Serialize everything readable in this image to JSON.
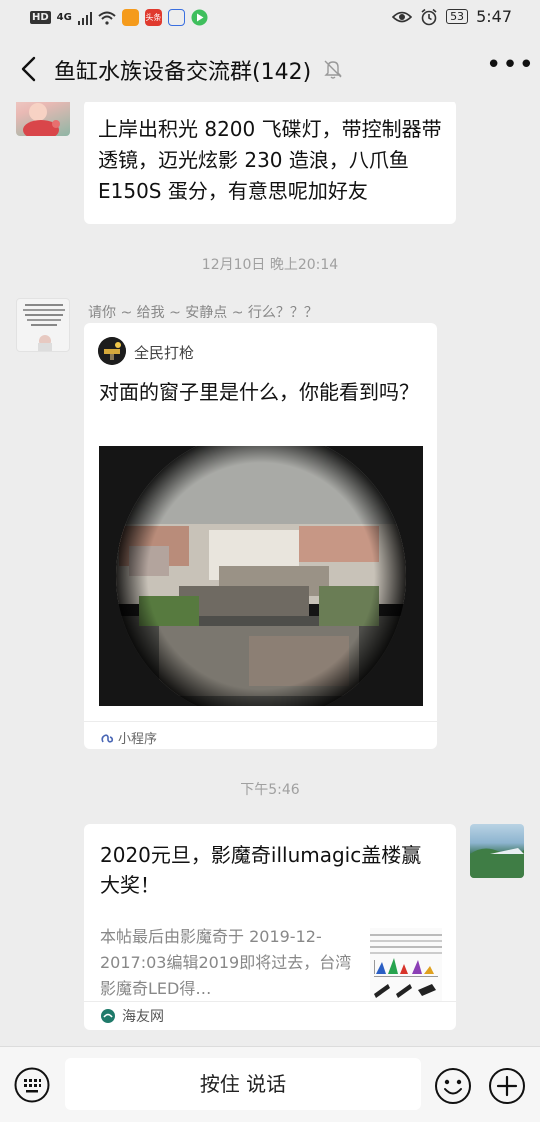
{
  "status_bar": {
    "hd": "HD",
    "signal": "4G",
    "app_badge": "头条",
    "battery": "53",
    "time": "5:47"
  },
  "header": {
    "title": "鱼缸水族设备交流群(142)",
    "back_icon": "chevron-left-icon",
    "mute_icon": "bell-off-icon",
    "more_label": "•••"
  },
  "messages": [
    {
      "type": "text",
      "text": "上岸出积光 8200 飞碟灯，带控制器带透镜，迈光炫影 230 造浪，八爪鱼 E150S 蛋分，有意思呢加好友"
    },
    {
      "type": "timestamp",
      "text": "12月10日 晚上20:14"
    },
    {
      "type": "mini_program",
      "sender_nickname": "请你 ~ 给我 ~ 安静点 ~ 行么？？？",
      "source_name": "全民打枪",
      "title": "对面的窗子里是什么，你能看到吗？",
      "footer": "小程序"
    },
    {
      "type": "timestamp",
      "text": "下午5:46"
    },
    {
      "type": "link",
      "title": "2020元旦，影魔奇illumagic盖楼赢大奖！",
      "description": "本帖最后由影魔奇于 2019-12-2017:03编辑2019即将过去，台湾影魔奇LED得…",
      "source": "海友网"
    }
  ],
  "bottom_bar": {
    "talk_label": "按住 说话",
    "keyboard_icon": "keyboard-icon",
    "emoji_icon": "smiley-icon",
    "plus_icon": "plus-circle-icon"
  }
}
